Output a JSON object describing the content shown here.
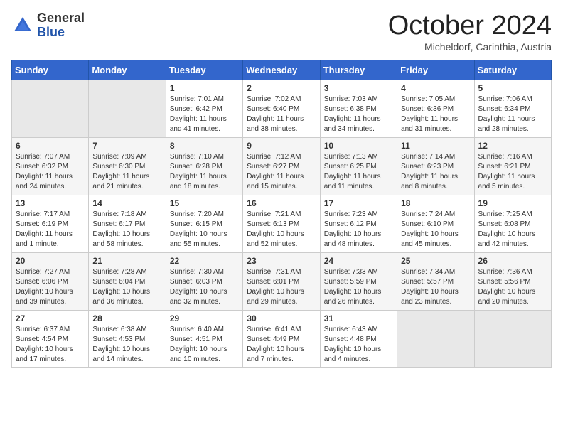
{
  "header": {
    "logo_line1": "General",
    "logo_line2": "Blue",
    "month": "October 2024",
    "location": "Micheldorf, Carinthia, Austria"
  },
  "weekdays": [
    "Sunday",
    "Monday",
    "Tuesday",
    "Wednesday",
    "Thursday",
    "Friday",
    "Saturday"
  ],
  "weeks": [
    [
      null,
      null,
      {
        "day": "1",
        "sunrise": "7:01 AM",
        "sunset": "6:42 PM",
        "daylight": "11 hours and 41 minutes."
      },
      {
        "day": "2",
        "sunrise": "7:02 AM",
        "sunset": "6:40 PM",
        "daylight": "11 hours and 38 minutes."
      },
      {
        "day": "3",
        "sunrise": "7:03 AM",
        "sunset": "6:38 PM",
        "daylight": "11 hours and 34 minutes."
      },
      {
        "day": "4",
        "sunrise": "7:05 AM",
        "sunset": "6:36 PM",
        "daylight": "11 hours and 31 minutes."
      },
      {
        "day": "5",
        "sunrise": "7:06 AM",
        "sunset": "6:34 PM",
        "daylight": "11 hours and 28 minutes."
      }
    ],
    [
      {
        "day": "6",
        "sunrise": "7:07 AM",
        "sunset": "6:32 PM",
        "daylight": "11 hours and 24 minutes."
      },
      {
        "day": "7",
        "sunrise": "7:09 AM",
        "sunset": "6:30 PM",
        "daylight": "11 hours and 21 minutes."
      },
      {
        "day": "8",
        "sunrise": "7:10 AM",
        "sunset": "6:28 PM",
        "daylight": "11 hours and 18 minutes."
      },
      {
        "day": "9",
        "sunrise": "7:12 AM",
        "sunset": "6:27 PM",
        "daylight": "11 hours and 15 minutes."
      },
      {
        "day": "10",
        "sunrise": "7:13 AM",
        "sunset": "6:25 PM",
        "daylight": "11 hours and 11 minutes."
      },
      {
        "day": "11",
        "sunrise": "7:14 AM",
        "sunset": "6:23 PM",
        "daylight": "11 hours and 8 minutes."
      },
      {
        "day": "12",
        "sunrise": "7:16 AM",
        "sunset": "6:21 PM",
        "daylight": "11 hours and 5 minutes."
      }
    ],
    [
      {
        "day": "13",
        "sunrise": "7:17 AM",
        "sunset": "6:19 PM",
        "daylight": "11 hours and 1 minute."
      },
      {
        "day": "14",
        "sunrise": "7:18 AM",
        "sunset": "6:17 PM",
        "daylight": "10 hours and 58 minutes."
      },
      {
        "day": "15",
        "sunrise": "7:20 AM",
        "sunset": "6:15 PM",
        "daylight": "10 hours and 55 minutes."
      },
      {
        "day": "16",
        "sunrise": "7:21 AM",
        "sunset": "6:13 PM",
        "daylight": "10 hours and 52 minutes."
      },
      {
        "day": "17",
        "sunrise": "7:23 AM",
        "sunset": "6:12 PM",
        "daylight": "10 hours and 48 minutes."
      },
      {
        "day": "18",
        "sunrise": "7:24 AM",
        "sunset": "6:10 PM",
        "daylight": "10 hours and 45 minutes."
      },
      {
        "day": "19",
        "sunrise": "7:25 AM",
        "sunset": "6:08 PM",
        "daylight": "10 hours and 42 minutes."
      }
    ],
    [
      {
        "day": "20",
        "sunrise": "7:27 AM",
        "sunset": "6:06 PM",
        "daylight": "10 hours and 39 minutes."
      },
      {
        "day": "21",
        "sunrise": "7:28 AM",
        "sunset": "6:04 PM",
        "daylight": "10 hours and 36 minutes."
      },
      {
        "day": "22",
        "sunrise": "7:30 AM",
        "sunset": "6:03 PM",
        "daylight": "10 hours and 32 minutes."
      },
      {
        "day": "23",
        "sunrise": "7:31 AM",
        "sunset": "6:01 PM",
        "daylight": "10 hours and 29 minutes."
      },
      {
        "day": "24",
        "sunrise": "7:33 AM",
        "sunset": "5:59 PM",
        "daylight": "10 hours and 26 minutes."
      },
      {
        "day": "25",
        "sunrise": "7:34 AM",
        "sunset": "5:57 PM",
        "daylight": "10 hours and 23 minutes."
      },
      {
        "day": "26",
        "sunrise": "7:36 AM",
        "sunset": "5:56 PM",
        "daylight": "10 hours and 20 minutes."
      }
    ],
    [
      {
        "day": "27",
        "sunrise": "6:37 AM",
        "sunset": "4:54 PM",
        "daylight": "10 hours and 17 minutes."
      },
      {
        "day": "28",
        "sunrise": "6:38 AM",
        "sunset": "4:53 PM",
        "daylight": "10 hours and 14 minutes."
      },
      {
        "day": "29",
        "sunrise": "6:40 AM",
        "sunset": "4:51 PM",
        "daylight": "10 hours and 10 minutes."
      },
      {
        "day": "30",
        "sunrise": "6:41 AM",
        "sunset": "4:49 PM",
        "daylight": "10 hours and 7 minutes."
      },
      {
        "day": "31",
        "sunrise": "6:43 AM",
        "sunset": "4:48 PM",
        "daylight": "10 hours and 4 minutes."
      },
      null,
      null
    ]
  ]
}
